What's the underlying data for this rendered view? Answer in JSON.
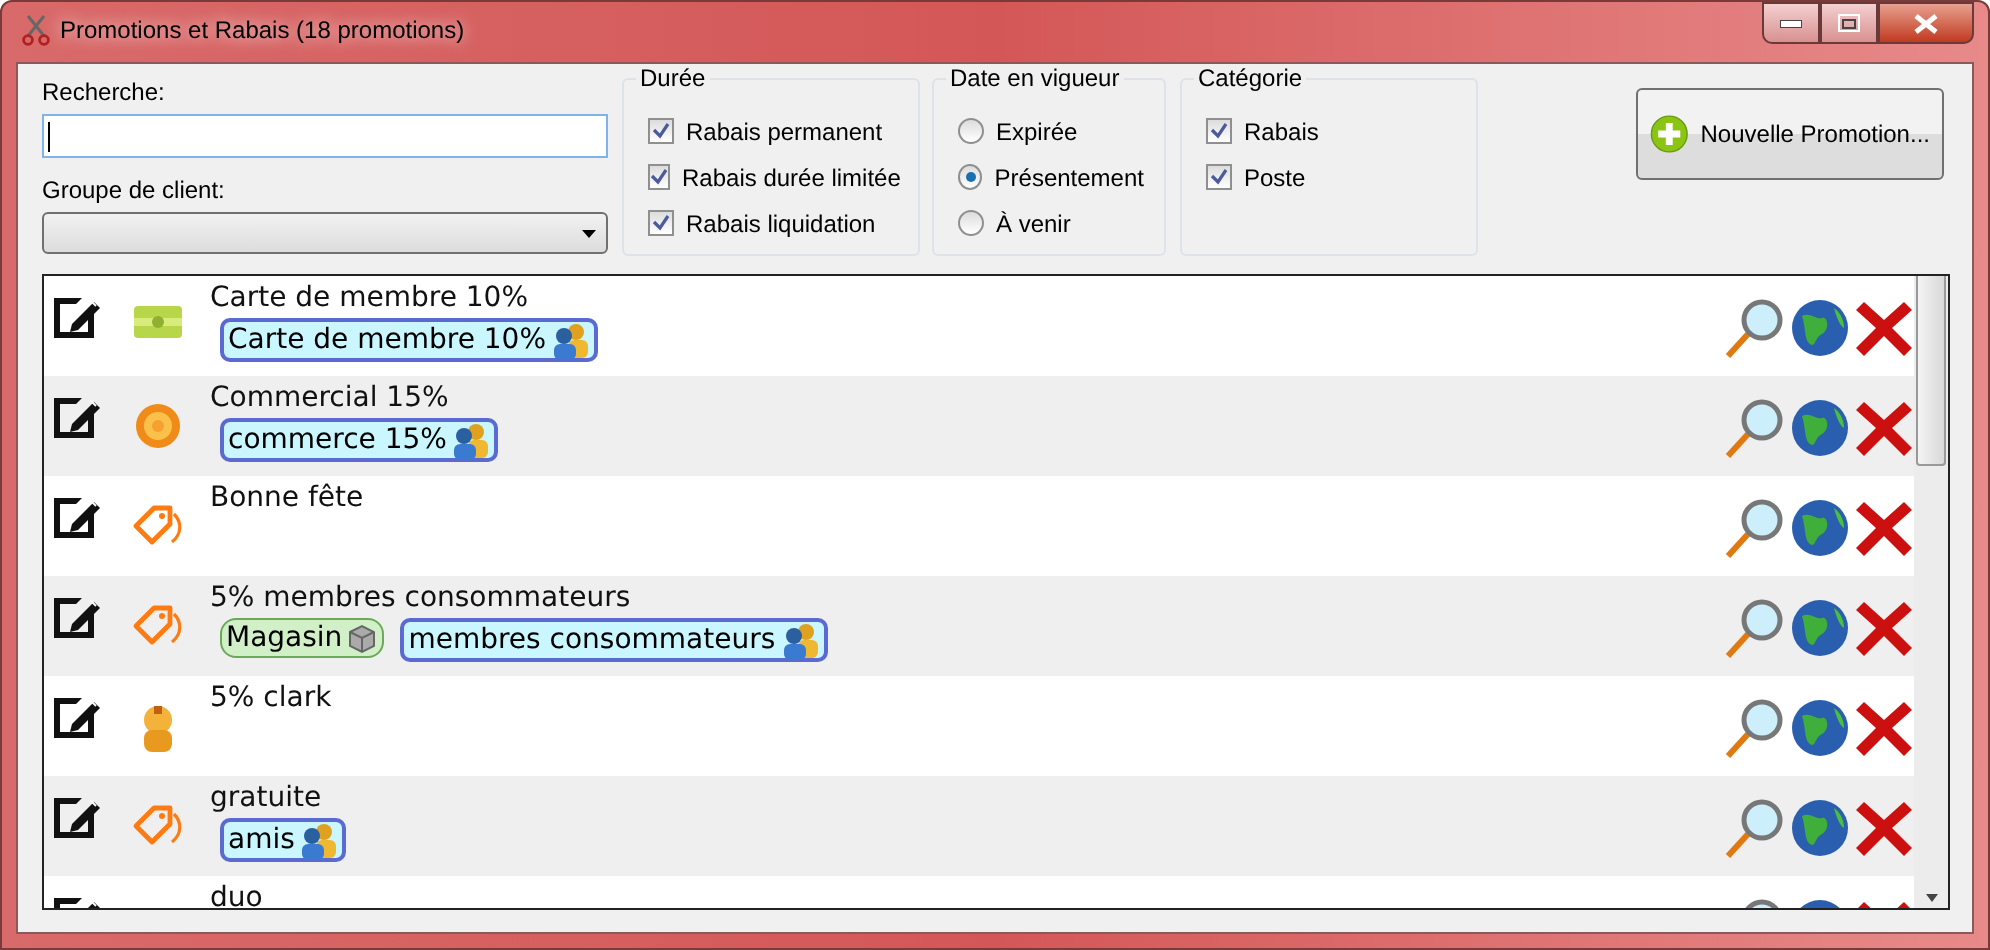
{
  "window": {
    "title": "Promotions et Rabais (18 promotions)"
  },
  "search": {
    "label": "Recherche:"
  },
  "client_group": {
    "label": "Groupe de client:"
  },
  "duration": {
    "title": "Durée",
    "options": [
      {
        "label": "Rabais permanent",
        "checked": true
      },
      {
        "label": "Rabais durée limitée",
        "checked": true
      },
      {
        "label": "Rabais liquidation",
        "checked": true
      }
    ]
  },
  "validity": {
    "title": "Date en vigueur",
    "options": [
      {
        "label": "Expirée",
        "selected": false
      },
      {
        "label": "Présentement",
        "selected": true
      },
      {
        "label": "À venir",
        "selected": false
      }
    ]
  },
  "category": {
    "title": "Catégorie",
    "options": [
      {
        "label": "Rabais",
        "checked": true
      },
      {
        "label": "Poste",
        "checked": true
      }
    ]
  },
  "new_button": {
    "label": "Nouvelle Promotion..."
  },
  "promotions": [
    {
      "name": "Carte de membre 10%",
      "kind": "card",
      "tags": [
        {
          "kind": "group",
          "label": "Carte de membre 10%"
        }
      ]
    },
    {
      "name": "Commercial 15%",
      "kind": "coin",
      "tags": [
        {
          "kind": "group",
          "label": "commerce 15%"
        }
      ]
    },
    {
      "name": "Bonne fête",
      "kind": "tag"
    },
    {
      "name": "5% membres consommateurs",
      "kind": "tag",
      "tags": [
        {
          "kind": "store",
          "label": "Magasin"
        },
        {
          "kind": "group",
          "label": "membres consommateurs"
        }
      ]
    },
    {
      "name": "5% clark",
      "kind": "person"
    },
    {
      "name": "gratuite",
      "kind": "tag",
      "tags": [
        {
          "kind": "group",
          "label": "amis"
        }
      ]
    },
    {
      "name": "duo"
    }
  ]
}
